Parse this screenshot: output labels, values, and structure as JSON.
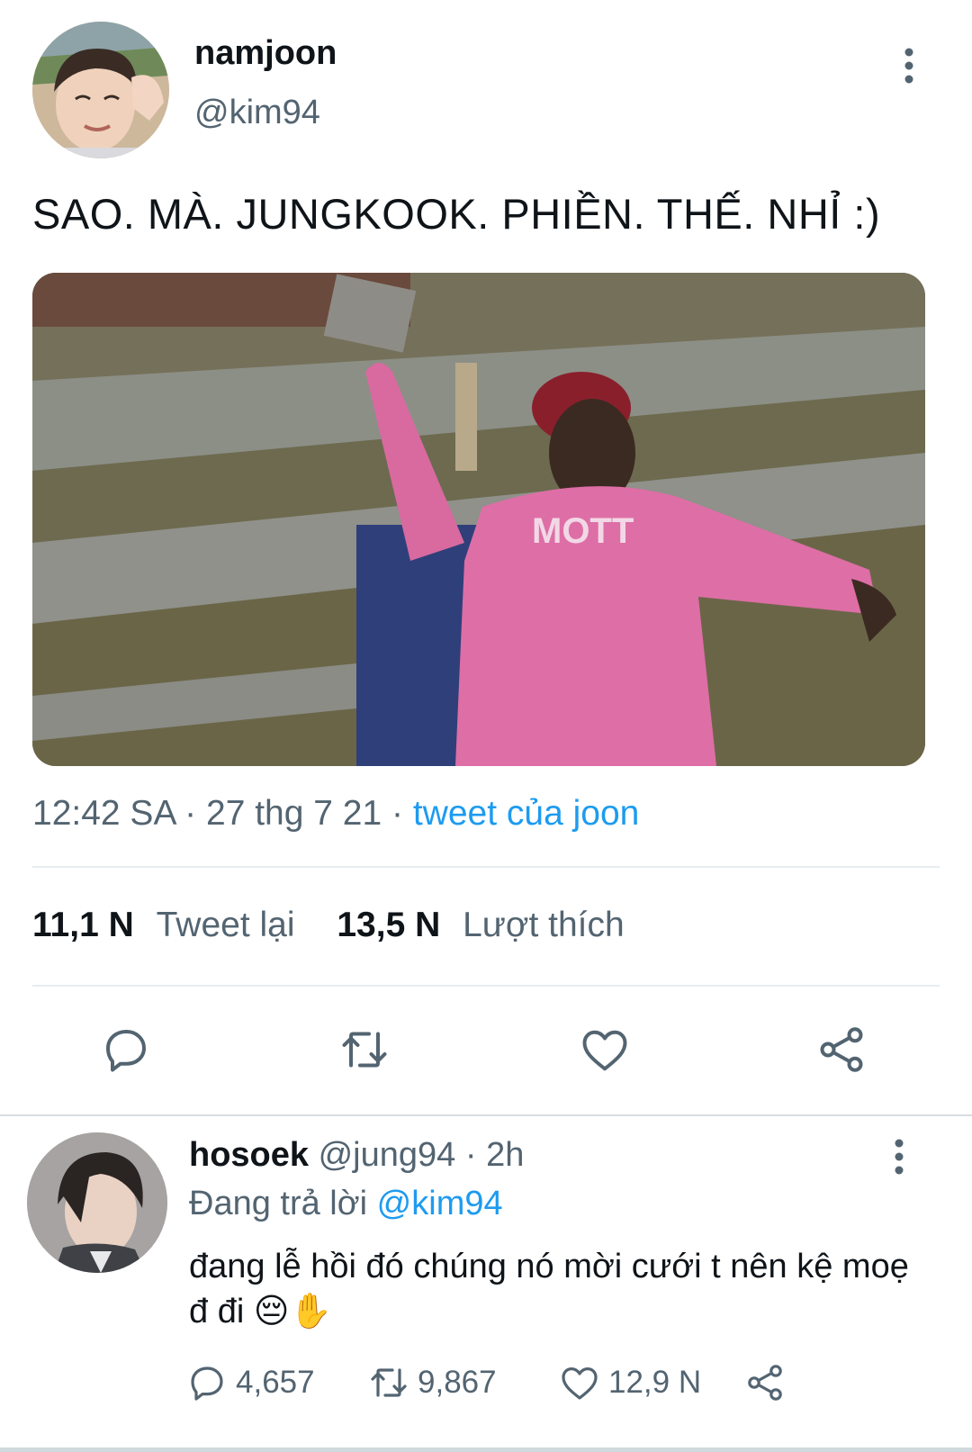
{
  "tweet": {
    "author_name": "namjoon",
    "author_handle": "@kim94",
    "text": "SAO. MÀ. JUNGKOOK. PHIỀN. THẾ. NHỈ :)",
    "time": "12:42 SA",
    "date": "27 thg 7 21",
    "separator": "·",
    "source": "tweet của joon",
    "retweets_count": "11,1 N",
    "retweets_label": "Tweet lại",
    "likes_count": "13,5 N",
    "likes_label": "Lượt thích"
  },
  "reply": {
    "author_name": "hosoek",
    "author_handle": "@jung94",
    "age": "2h",
    "replying_label": "Đang trả lời",
    "replying_to": "@kim94",
    "text": "đang lễ hồi đó chúng nó mời cưới t nên kệ moẹ đ đi 😔✋",
    "reply_count": "4,657",
    "retweet_count": "9,867",
    "like_count": "12,9 N"
  },
  "colors": {
    "link": "#1d9bf0",
    "muted": "#536471",
    "text": "#0f1419"
  },
  "icons": [
    "more-vertical-icon",
    "reply-icon",
    "retweet-icon",
    "like-icon",
    "share-icon"
  ]
}
